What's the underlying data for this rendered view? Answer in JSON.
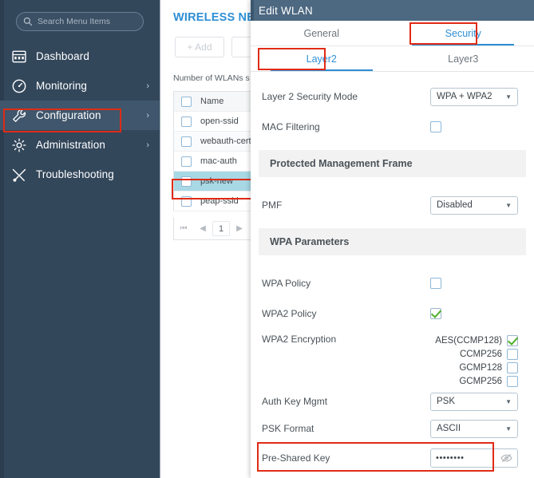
{
  "sidebar": {
    "search": {
      "placeholder": "Search Menu Items",
      "value": ""
    },
    "items": [
      {
        "label": "Dashboard",
        "icon": "dashboard-icon",
        "chevron": ""
      },
      {
        "label": "Monitoring",
        "icon": "gauge-icon",
        "chevron": "›"
      },
      {
        "label": "Configuration",
        "icon": "wrench-icon",
        "chevron": "›"
      },
      {
        "label": "Administration",
        "icon": "gear-icon",
        "chevron": "›"
      },
      {
        "label": "Troubleshooting",
        "icon": "tools-icon",
        "chevron": ""
      }
    ],
    "active_item": "Configuration"
  },
  "middle": {
    "page_title": "WIRELESS NET",
    "add_button": "+ Add",
    "delete_button": "",
    "wlan_count_text": "Number of WLANs s",
    "table": {
      "columns": [
        "",
        "Name"
      ],
      "rows": [
        {
          "name": "open-ssid",
          "checked": false,
          "selected": false
        },
        {
          "name": "webauth-cert",
          "checked": false,
          "selected": false
        },
        {
          "name": "mac-auth",
          "checked": false,
          "selected": false
        },
        {
          "name": "psk-new",
          "checked": false,
          "selected": true
        },
        {
          "name": "peap-ssid",
          "checked": false,
          "selected": false
        }
      ]
    },
    "pagination": {
      "first": "⏮",
      "prev": "◀",
      "page": "1",
      "next": "▶"
    }
  },
  "modal": {
    "title": "Edit WLAN",
    "tabs_primary": [
      {
        "label": "General",
        "active": false,
        "highlighted": false
      },
      {
        "label": "Security",
        "active": true,
        "highlighted": true
      }
    ],
    "tabs_secondary": [
      {
        "label": "Layer2",
        "active": true,
        "highlighted": true
      },
      {
        "label": "Layer3",
        "active": false,
        "highlighted": false
      }
    ],
    "fields": {
      "layer2_security_mode": {
        "label": "Layer 2 Security Mode",
        "value": "WPA + WPA2"
      },
      "mac_filtering": {
        "label": "MAC Filtering",
        "checked": false
      },
      "pmf_section": {
        "label": "Protected Management Frame"
      },
      "pmf": {
        "label": "PMF",
        "value": "Disabled"
      },
      "wpa_section": {
        "label": "WPA Parameters"
      },
      "wpa_policy": {
        "label": "WPA Policy",
        "checked": false
      },
      "wpa2_policy": {
        "label": "WPA2 Policy",
        "checked": true
      },
      "wpa2_encryption": {
        "label": "WPA2 Encryption",
        "options": [
          {
            "label": "AES(CCMP128)",
            "checked": true
          },
          {
            "label": "CCMP256",
            "checked": false
          },
          {
            "label": "GCMP128",
            "checked": false
          },
          {
            "label": "GCMP256",
            "checked": false
          }
        ]
      },
      "auth_key_mgmt": {
        "label": "Auth Key Mgmt",
        "value": "PSK"
      },
      "psk_format": {
        "label": "PSK Format",
        "value": "ASCII"
      },
      "pre_shared_key": {
        "label": "Pre-Shared Key",
        "value": "••••••••",
        "icon": "eye-slash-icon",
        "highlighted": true
      }
    }
  },
  "colors": {
    "sidebar_bg": "#33475b",
    "sidebar_active": "#3f566c",
    "modal_header": "#4d6881",
    "accent_blue": "#2e8fd4",
    "highlight_red": "#e02b15",
    "check_green": "#4caf28",
    "row_selected": "#a8d8e4"
  }
}
